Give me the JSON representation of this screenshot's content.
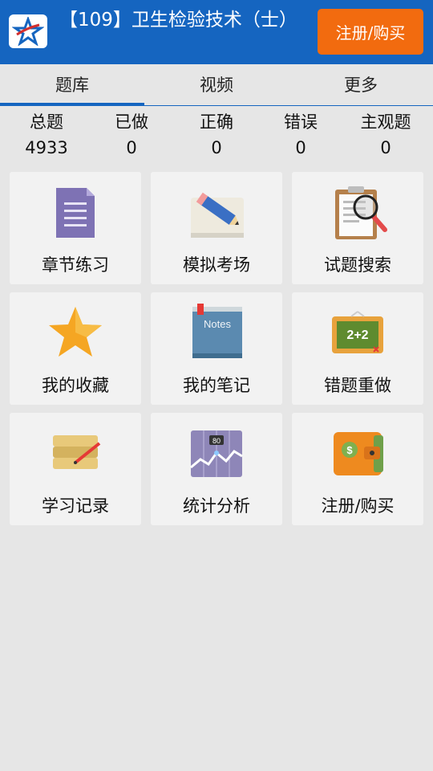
{
  "header": {
    "title": "【109】卫生检验技术（士）",
    "button_label": "注册/购买"
  },
  "tabs": [
    {
      "label": "题库",
      "active": true
    },
    {
      "label": "视频",
      "active": false
    },
    {
      "label": "更多",
      "active": false
    }
  ],
  "stats": [
    {
      "label": "总题",
      "value": "4933"
    },
    {
      "label": "已做",
      "value": "0"
    },
    {
      "label": "正确",
      "value": "0"
    },
    {
      "label": "错误",
      "value": "0"
    },
    {
      "label": "主观题",
      "value": "0"
    }
  ],
  "tiles": [
    {
      "label": "章节练习",
      "icon": "document-list-icon"
    },
    {
      "label": "模拟考场",
      "icon": "pencil-paper-icon"
    },
    {
      "label": "试题搜索",
      "icon": "clipboard-search-icon"
    },
    {
      "label": "我的收藏",
      "icon": "star-icon"
    },
    {
      "label": "我的笔记",
      "icon": "notes-book-icon"
    },
    {
      "label": "错题重做",
      "icon": "chalkboard-icon"
    },
    {
      "label": "学习记录",
      "icon": "scroll-pencil-icon"
    },
    {
      "label": "统计分析",
      "icon": "stats-chart-icon"
    },
    {
      "label": "注册/购买",
      "icon": "wallet-icon"
    }
  ],
  "icon_text": {
    "notes": "Notes",
    "board": "2+2",
    "chart": "80",
    "wallet": "$"
  },
  "colors": {
    "header": "#1565c0",
    "accent": "#f26b0f",
    "background": "#e6e6e6",
    "tile": "#f2f2f2"
  }
}
